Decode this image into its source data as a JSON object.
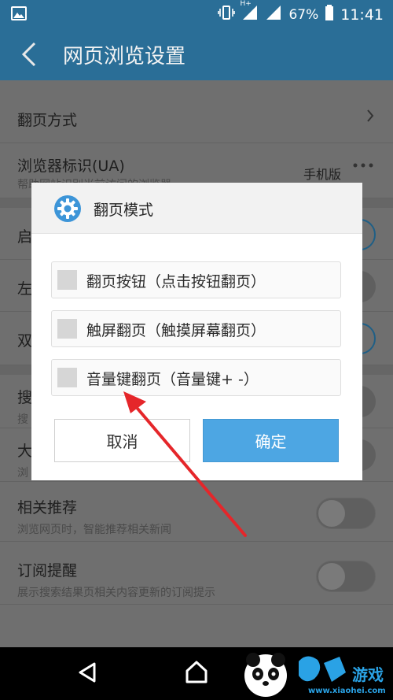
{
  "status_bar": {
    "signal_label": "H+",
    "battery": "67%",
    "time": "11:41"
  },
  "app_bar": {
    "title": "网页浏览设置"
  },
  "settings": {
    "page_turn_mode": {
      "title": "翻页方式"
    },
    "browser_ua": {
      "title": "浏览器标识(UA)",
      "subtitle": "帮助网站识别当前访问的浏览器",
      "value": "手机版"
    },
    "partial_rows": [
      "启",
      "左",
      "双",
      "搜",
      "搜",
      "大",
      "浏"
    ],
    "related": {
      "title": "相关推荐",
      "subtitle": "浏览网页时，智能推荐相关新闻"
    },
    "subscribe": {
      "title": "订阅提醒",
      "subtitle": "展示搜索结果页相关内容更新的订阅提示"
    }
  },
  "dialog": {
    "title": "翻页模式",
    "options": [
      {
        "label": "翻页按钮（点击按钮翻页）",
        "checked": false
      },
      {
        "label": "触屏翻页（触摸屏幕翻页）",
        "checked": false
      },
      {
        "label": "音量键翻页（音量键+ -）",
        "checked": false
      }
    ],
    "cancel_label": "取消",
    "ok_label": "确定"
  },
  "watermark": {
    "text": "www.xiaohei.com"
  },
  "colors": {
    "app_bar": "#2a6e97",
    "ok_button": "#4da6e3",
    "annotation_arrow": "#e5262a"
  }
}
